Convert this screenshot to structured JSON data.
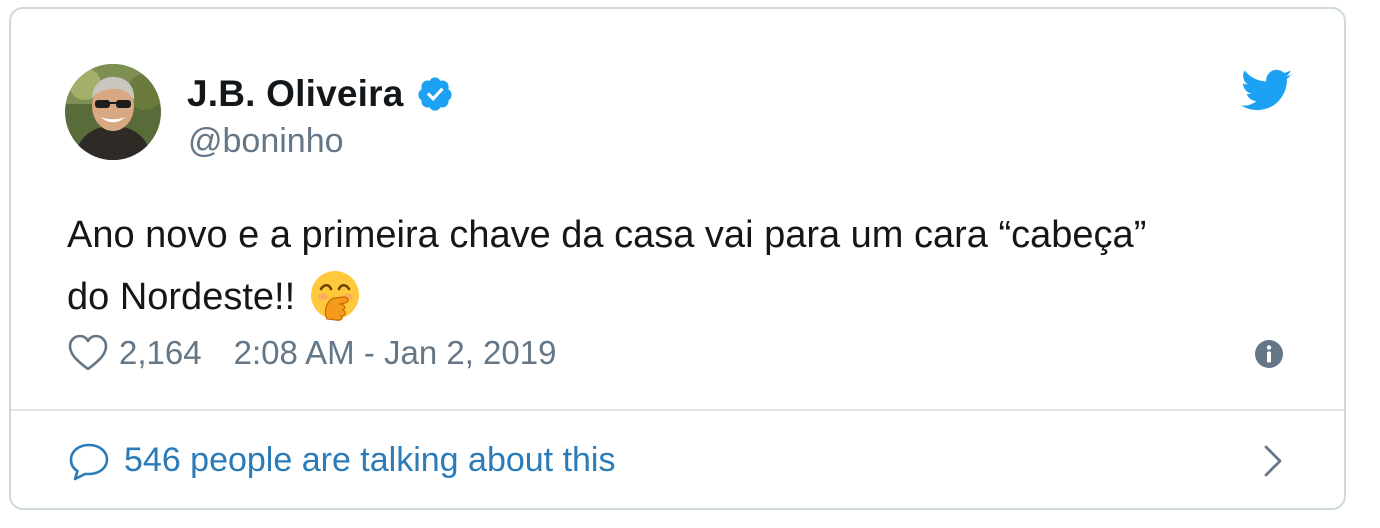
{
  "author": {
    "name": "J.B. Oliveira",
    "handle": "@boninho",
    "verified": true,
    "avatar": "profile-photo"
  },
  "tweet": {
    "text_lines": [
      "Ano novo e a primeira chave da casa vai para um cara “cabeça”",
      "do Nordeste!!"
    ],
    "emoji": "face-with-hand-over-mouth"
  },
  "meta": {
    "likes": "2,164",
    "timestamp": "2:08 AM - Jan 2, 2019"
  },
  "footer": {
    "talking_text": "546 people are talking about this"
  },
  "icons": {
    "brand": "twitter-bird-icon",
    "verified": "verified-badge-icon",
    "like": "heart-icon",
    "info": "info-icon",
    "reply": "speech-bubble-icon",
    "navigate": "chevron-right-icon"
  },
  "colors": {
    "twitter_blue": "#1da1f2",
    "link_blue": "#2b7bb9",
    "text": "#14171a",
    "secondary": "#657786",
    "border": "#cfd9de"
  }
}
